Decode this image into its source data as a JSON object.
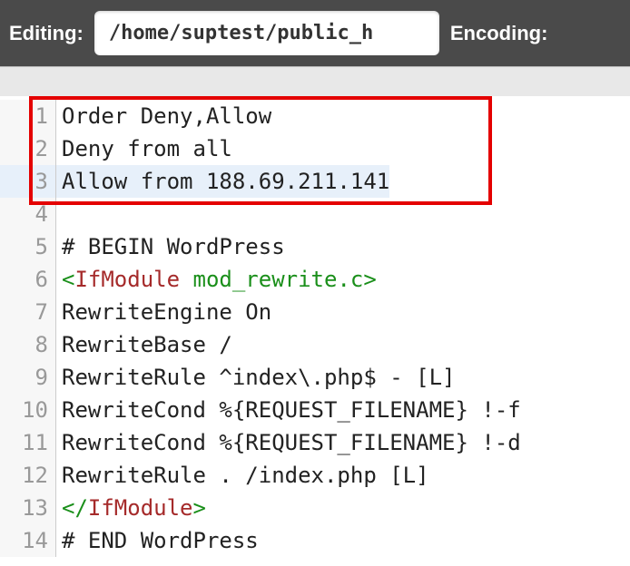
{
  "toolbar": {
    "editing_label": "Editing:",
    "path_value": "/home/suptest/public_h",
    "encoding_label": "Encoding:"
  },
  "code": {
    "lines": [
      {
        "num": "1",
        "plain": "Order Deny,Allow"
      },
      {
        "num": "2",
        "plain": "Deny from all"
      },
      {
        "num": "3",
        "plain": "Allow from 188.69.211.141",
        "active": true
      },
      {
        "num": "4",
        "plain": ""
      },
      {
        "num": "5",
        "plain": "# BEGIN WordPress"
      },
      {
        "num": "6",
        "segments": [
          {
            "t": "<",
            "c": "tag-green"
          },
          {
            "t": "IfModule",
            "c": "tag-brown"
          },
          {
            "t": " mod_rewrite.c",
            "c": "tag-green"
          },
          {
            "t": ">",
            "c": "tag-green"
          }
        ]
      },
      {
        "num": "7",
        "plain": "RewriteEngine On"
      },
      {
        "num": "8",
        "plain": "RewriteBase /"
      },
      {
        "num": "9",
        "plain": "RewriteRule ^index\\.php$ - [L]"
      },
      {
        "num": "10",
        "plain": "RewriteCond %{REQUEST_FILENAME} !-f"
      },
      {
        "num": "11",
        "plain": "RewriteCond %{REQUEST_FILENAME} !-d"
      },
      {
        "num": "12",
        "plain": "RewriteRule . /index.php [L]"
      },
      {
        "num": "13",
        "segments": [
          {
            "t": "</",
            "c": "tag-green"
          },
          {
            "t": "IfModule",
            "c": "tag-brown"
          },
          {
            "t": ">",
            "c": "tag-green"
          }
        ]
      },
      {
        "num": "14",
        "plain": "# END WordPress"
      }
    ]
  }
}
